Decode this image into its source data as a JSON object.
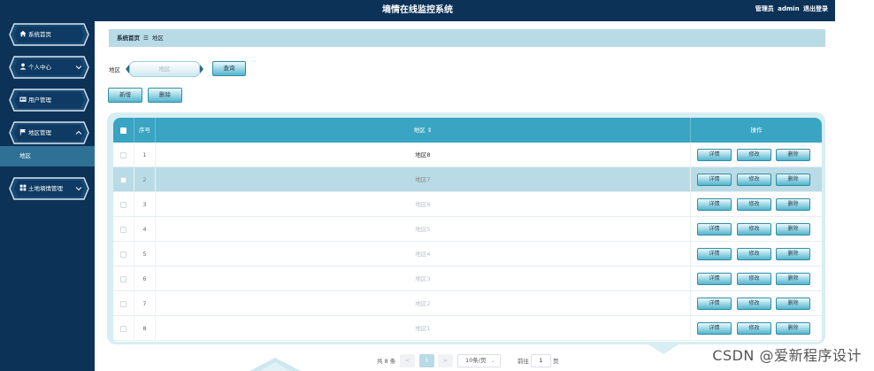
{
  "header": {
    "title": "墒情在线监控系统",
    "role": "管理员",
    "username": "admin",
    "logout": "退出登录"
  },
  "sidebar": {
    "items": [
      {
        "label": "系统首页",
        "icon": "home-icon"
      },
      {
        "label": "个人中心",
        "icon": "user-icon",
        "has_chevron": true
      },
      {
        "label": "用户管理",
        "icon": "id-card-icon"
      },
      {
        "label": "地区管理",
        "icon": "flag-icon",
        "has_chevron": true,
        "expanded": true
      },
      {
        "label": "土地墒情管理",
        "icon": "grid-icon",
        "has_chevron": true
      }
    ],
    "submenu": {
      "label": "地区"
    }
  },
  "breadcrumb": {
    "home": "系统首页",
    "separator": "☰",
    "current": "地区"
  },
  "search": {
    "label": "地区",
    "placeholder": "地区",
    "button": "查询"
  },
  "actions": {
    "add": "新增",
    "delete": "删除"
  },
  "table": {
    "columns": {
      "index": "序号",
      "area": "地区",
      "sort_icon": "⇕",
      "operation": "操作"
    },
    "rows": [
      {
        "index": "1",
        "area": "地区8"
      },
      {
        "index": "2",
        "area": "地区7"
      },
      {
        "index": "3",
        "area": "地区6"
      },
      {
        "index": "4",
        "area": "地区5"
      },
      {
        "index": "5",
        "area": "地区4"
      },
      {
        "index": "6",
        "area": "地区3"
      },
      {
        "index": "7",
        "area": "地区2"
      },
      {
        "index": "8",
        "area": "地区1"
      }
    ],
    "selected_row": 1,
    "row_buttons": {
      "detail": "详情",
      "edit": "修改",
      "delete": "删除"
    }
  },
  "pagination": {
    "total": "共 8 条",
    "prev": "<",
    "current": "1",
    "next": ">",
    "page_size": "10条/页",
    "goto": "前往",
    "goto_value": "1",
    "page_unit": "页"
  },
  "watermark": "CSDN @爱新程序设计",
  "colors": {
    "header": "#0d3258",
    "accent": "#3aa4c3",
    "highlight": "#b9dbe5"
  }
}
